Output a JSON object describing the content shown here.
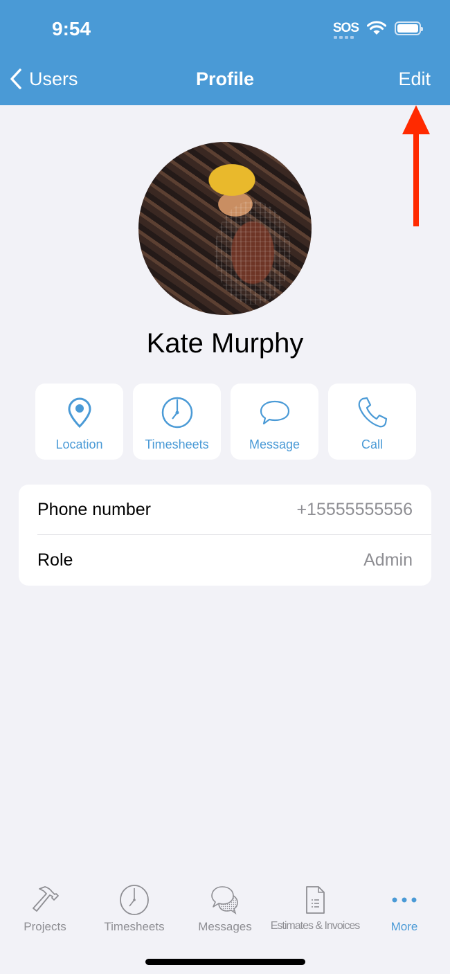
{
  "status_bar": {
    "time": "9:54",
    "sos": "SOS",
    "icons": [
      "sos-indicator",
      "wifi-icon",
      "battery-icon"
    ]
  },
  "nav": {
    "back_label": "Users",
    "title": "Profile",
    "edit_label": "Edit"
  },
  "colors": {
    "brand": "#4a9ad6",
    "background": "#f2f2f7",
    "annotation_arrow": "#ff2a00",
    "secondary_text": "#8e8e93"
  },
  "annotation": {
    "type": "arrow",
    "points_to": "Edit"
  },
  "profile": {
    "name": "Kate Murphy",
    "avatar": "photo of worker in yellow hard hat"
  },
  "actions": [
    {
      "label": "Location",
      "icon": "location-pin-icon"
    },
    {
      "label": "Timesheets",
      "icon": "clock-icon"
    },
    {
      "label": "Message",
      "icon": "chat-bubble-icon"
    },
    {
      "label": "Call",
      "icon": "phone-icon"
    }
  ],
  "info": [
    {
      "label": "Phone number",
      "value": "+15555555556"
    },
    {
      "label": "Role",
      "value": "Admin"
    }
  ],
  "tabbar": {
    "items": [
      {
        "label": "Projects",
        "icon": "hammer-icon",
        "active": false
      },
      {
        "label": "Timesheets",
        "icon": "clock-icon",
        "active": false
      },
      {
        "label": "Messages",
        "icon": "chat-bubbles-icon",
        "active": false
      },
      {
        "label": "Estimates & Invoices",
        "icon": "document-icon",
        "active": false
      },
      {
        "label": "More",
        "icon": "more-dots-icon",
        "active": true
      }
    ]
  }
}
